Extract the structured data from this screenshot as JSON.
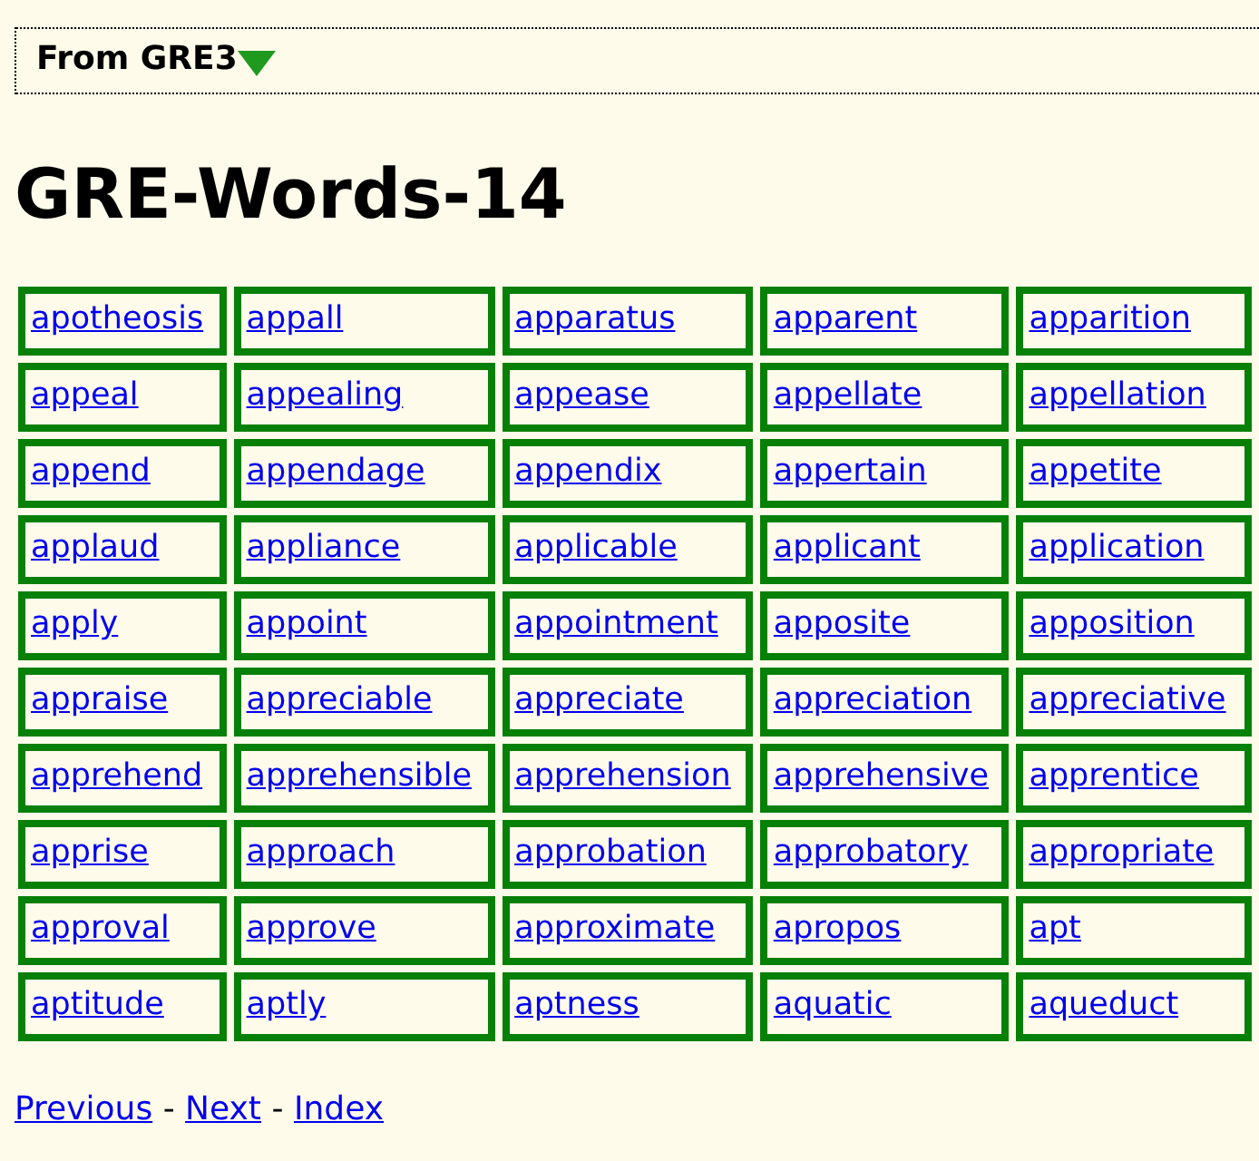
{
  "breadcrumb": {
    "label": "From GRE3"
  },
  "title": "GRE-Words-14",
  "words": [
    [
      "apotheosis",
      "appall",
      "apparatus",
      "apparent",
      "apparition"
    ],
    [
      "appeal",
      "appealing",
      "appease",
      "appellate",
      "appellation"
    ],
    [
      "append",
      "appendage",
      "appendix",
      "appertain",
      "appetite"
    ],
    [
      "applaud",
      "appliance",
      "applicable",
      "applicant",
      "application"
    ],
    [
      "apply",
      "appoint",
      "appointment",
      "apposite",
      "apposition"
    ],
    [
      "appraise",
      "appreciable",
      "appreciate",
      "appreciation",
      "appreciative"
    ],
    [
      "apprehend",
      "apprehensible",
      "apprehension",
      "apprehensive",
      "apprentice"
    ],
    [
      "apprise",
      "approach",
      "approbation",
      "approbatory",
      "appropriate"
    ],
    [
      "approval",
      "approve",
      "approximate",
      "apropos",
      "apt"
    ],
    [
      "aptitude",
      "aptly",
      "aptness",
      "aquatic",
      "aqueduct"
    ]
  ],
  "footer": [
    {
      "kind": "link",
      "text": "Previous"
    },
    {
      "kind": "separator",
      "text": "-"
    },
    {
      "kind": "link",
      "text": "Next"
    },
    {
      "kind": "separator",
      "text": "-"
    },
    {
      "kind": "link",
      "text": "Index"
    }
  ]
}
